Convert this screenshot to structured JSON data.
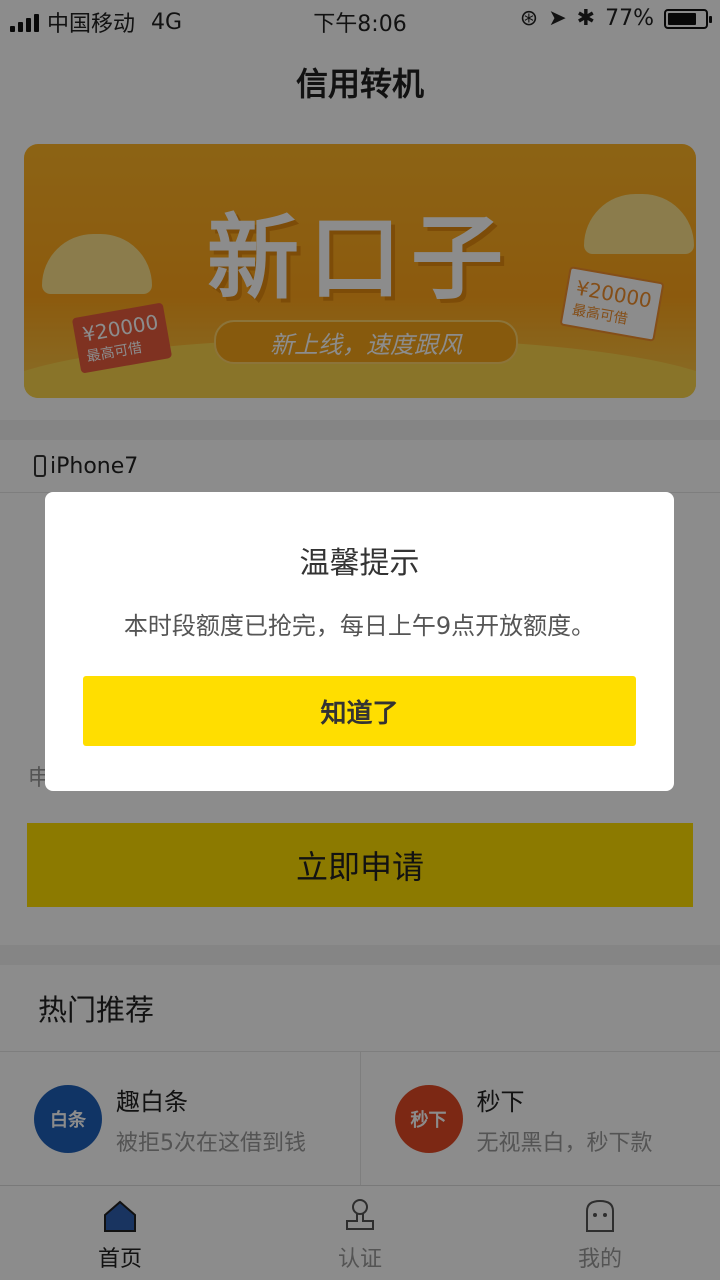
{
  "status_bar": {
    "carrier": "中国移动",
    "network": "4G",
    "time": "下午8:06",
    "battery": "77%",
    "battery_level": 0.77
  },
  "nav": {
    "title": "信用转机"
  },
  "banner": {
    "title": "新口子",
    "subtitle": "新上线，速度跟风",
    "ticket_left_amount": "¥20000",
    "ticket_left_note": "最高可借",
    "ticket_right_amount": "¥20000",
    "ticket_right_note": "最高可借"
  },
  "device": {
    "model": "iPhone7"
  },
  "apply": {
    "label_partial": "申",
    "button_label": "立即申请"
  },
  "hot": {
    "title": "热门推荐",
    "items": [
      {
        "name": "趣白条",
        "desc": "被拒5次在这借到钱",
        "logo_text": "白条",
        "logo_color": "#1e5fb8"
      },
      {
        "name": "秒下",
        "desc": "无视黑白，秒下款",
        "logo_text": "秒下",
        "logo_color": "#e24a25"
      }
    ]
  },
  "tabs": [
    {
      "label": "首页",
      "icon": "home-icon",
      "active": true
    },
    {
      "label": "认证",
      "icon": "stamp-icon",
      "active": false
    },
    {
      "label": "我的",
      "icon": "profile-icon",
      "active": false
    }
  ],
  "modal": {
    "title": "温馨提示",
    "message": "本时段额度已抢完，每日上午9点开放额度。",
    "button_label": "知道了"
  },
  "colors": {
    "accent": "#ffde00",
    "banner": "#ffa51a"
  }
}
